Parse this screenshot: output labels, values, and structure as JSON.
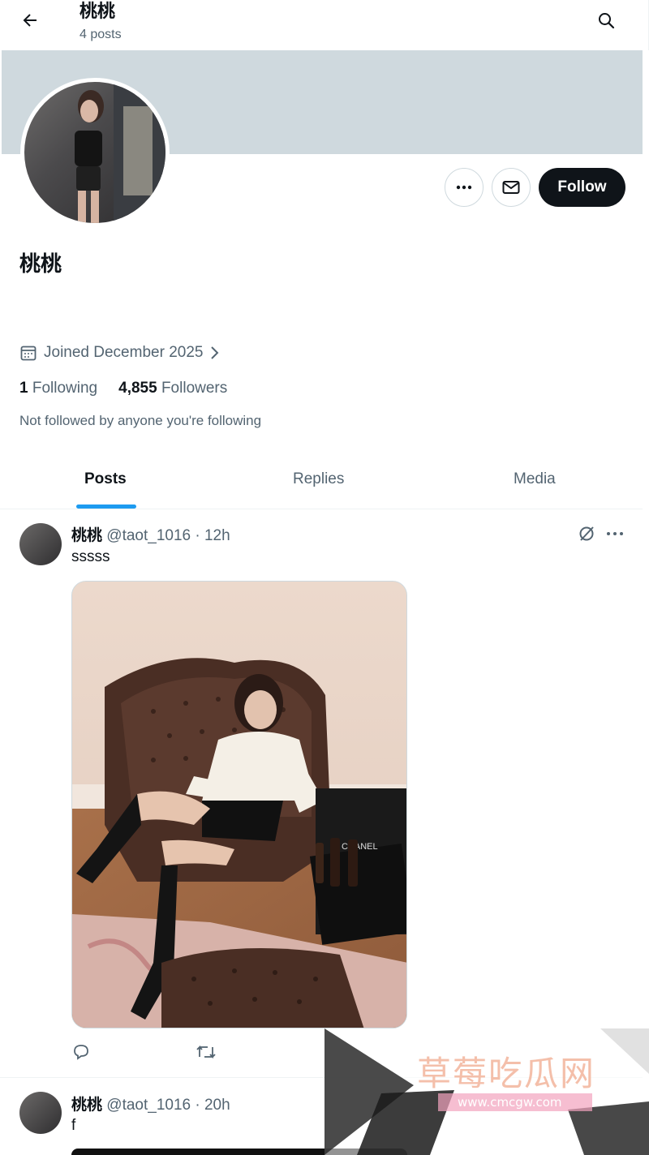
{
  "header": {
    "title": "桃桃",
    "subtitle": "4 posts"
  },
  "profile": {
    "display_name": "桃桃",
    "follow_label": "Follow",
    "joined": "Joined December 2025",
    "following_count": "1",
    "following_label": "Following",
    "followers_count": "4,855",
    "followers_label": "Followers",
    "not_followed": "Not followed by anyone you're following"
  },
  "tabs": [
    {
      "label": "Posts",
      "active": true
    },
    {
      "label": "Replies",
      "active": false
    },
    {
      "label": "Media",
      "active": false
    }
  ],
  "posts": [
    {
      "name": "桃桃",
      "meta": "@taot_1016 · 12h",
      "text": "sssss"
    },
    {
      "name": "桃桃",
      "meta": "@taot_1016 · 20h",
      "text": "f"
    }
  ],
  "watermark": {
    "title": "草莓吃瓜网",
    "url": "www.cmcgw.com"
  },
  "colors": {
    "accent": "#1d9bf0",
    "banner": "#cfd9de",
    "text_primary": "#0f1419",
    "text_secondary": "#536471"
  },
  "icons": [
    "back-arrow-icon",
    "search-icon",
    "more-icon",
    "mail-icon",
    "calendar-icon",
    "chevron-right-icon",
    "grok-icon",
    "reply-icon",
    "retweet-icon"
  ]
}
